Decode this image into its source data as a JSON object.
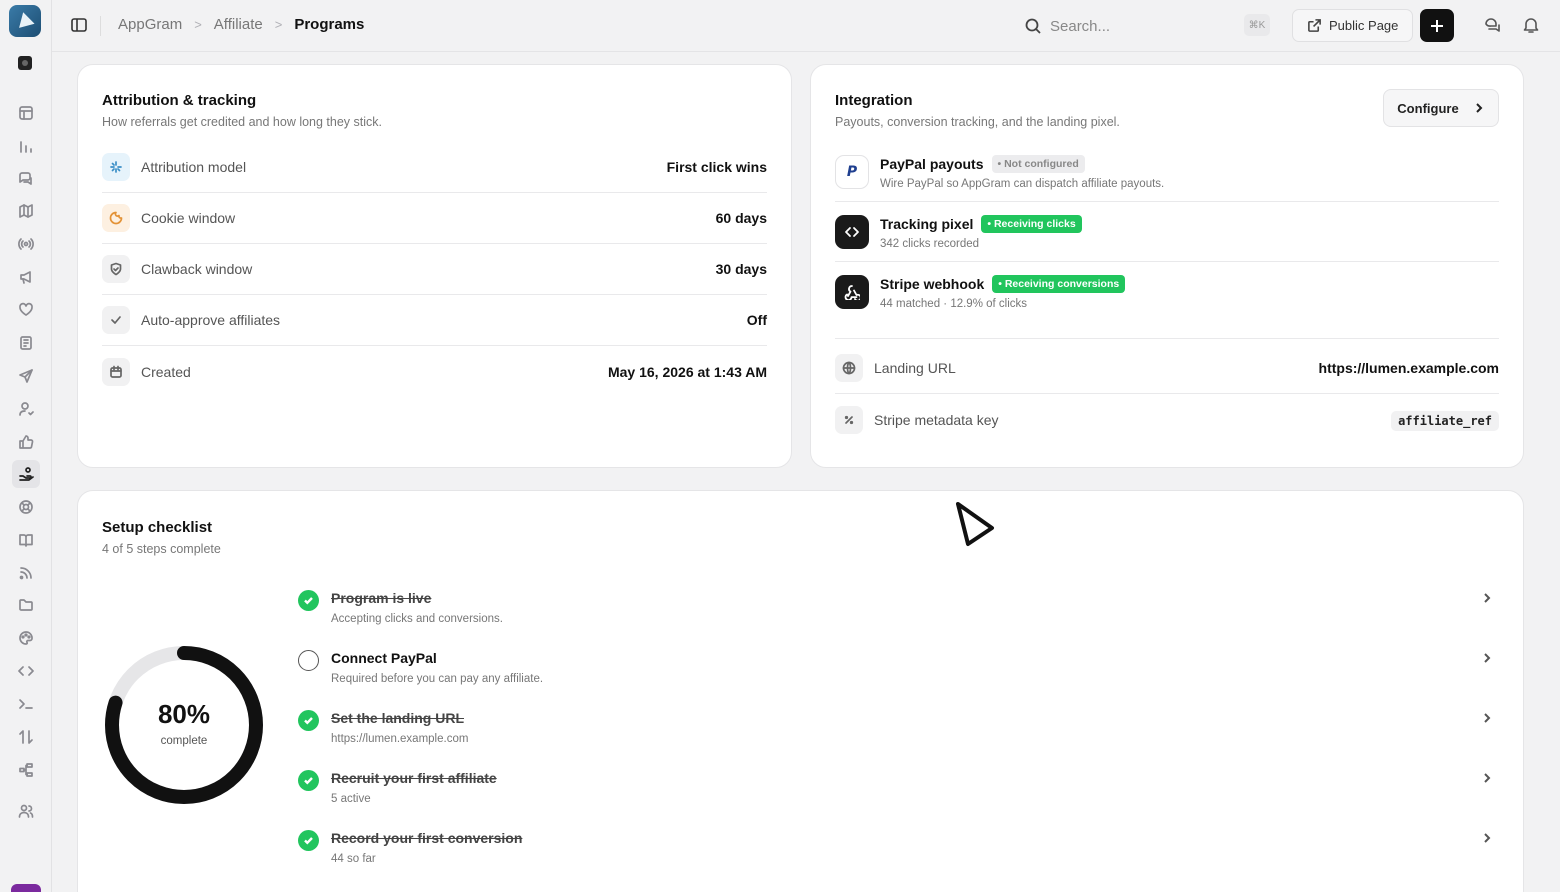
{
  "breadcrumbs": [
    "AppGram",
    "Affiliate",
    "Programs"
  ],
  "search": {
    "placeholder": "Search...",
    "shortcut": "⌘K"
  },
  "topbar": {
    "public_page_label": "Public Page"
  },
  "attribution": {
    "title": "Attribution & tracking",
    "subtitle": "How referrals get credited and how long they stick.",
    "rows": [
      {
        "label": "Attribution model",
        "value": "First click wins",
        "icon": "sparkle-icon"
      },
      {
        "label": "Cookie window",
        "value": "60 days",
        "icon": "cookie-icon"
      },
      {
        "label": "Clawback window",
        "value": "30 days",
        "icon": "shield-icon"
      },
      {
        "label": "Auto-approve affiliates",
        "value": "Off",
        "icon": "check-icon"
      },
      {
        "label": "Created",
        "value": "May 16, 2026 at 1:43 AM",
        "icon": "calendar-icon"
      }
    ]
  },
  "integration": {
    "title": "Integration",
    "subtitle": "Payouts, conversion tracking, and the landing pixel.",
    "configure_label": "Configure",
    "items": [
      {
        "title": "PayPal payouts",
        "badge": "• Not configured",
        "desc": "Wire PayPal so AppGram can dispatch affiliate payouts.",
        "icon": "paypal-icon"
      },
      {
        "title": "Tracking pixel",
        "badge": "• Receiving clicks",
        "desc": "342 clicks recorded",
        "icon": "code-icon"
      },
      {
        "title": "Stripe webhook",
        "badge": "• Receiving conversions",
        "desc": "44 matched · 12.9% of clicks",
        "icon": "webhook-icon"
      }
    ],
    "rows": [
      {
        "label": "Landing URL",
        "value": "https://lumen.example.com",
        "icon": "globe-icon"
      },
      {
        "label": "Stripe metadata key",
        "value": "affiliate_ref",
        "icon": "percent-icon"
      }
    ]
  },
  "checklist": {
    "title": "Setup checklist",
    "subtitle": "4 of 5 steps complete",
    "percent_label": "80%",
    "percent_value": 0.8,
    "complete_label": "complete",
    "steps": [
      {
        "title": "Program is live",
        "desc": "Accepting clicks and conversions.",
        "done": true
      },
      {
        "title": "Connect PayPal",
        "desc": "Required before you can pay any affiliate.",
        "done": false
      },
      {
        "title": "Set the landing URL",
        "desc": "https://lumen.example.com",
        "done": true
      },
      {
        "title": "Recruit your first affiliate",
        "desc": "5 active",
        "done": true
      },
      {
        "title": "Record your first conversion",
        "desc": "44 so far",
        "done": true
      }
    ]
  },
  "colors": {
    "accent_green": "#22c55e",
    "dark": "#111111"
  }
}
